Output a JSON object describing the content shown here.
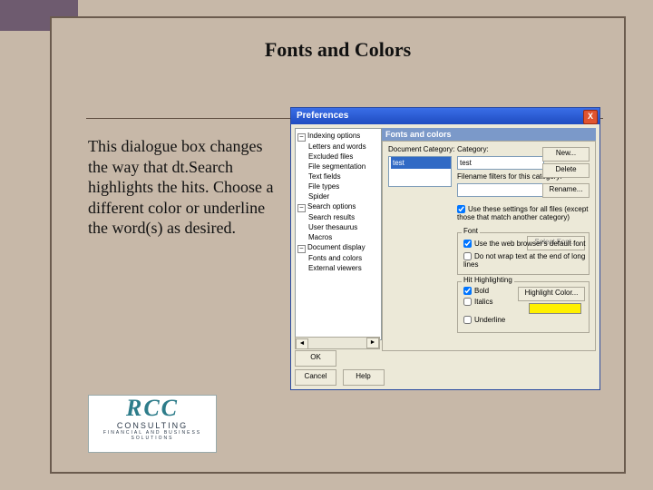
{
  "page_title": "Fonts and Colors",
  "body_text": "This dialogue box changes the way that dt.Search highlights the hits.  Choose a different color or underline the word(s) as desired.",
  "logo": {
    "line1": "RCC",
    "line2": "CONSULTING",
    "line3": "FINANCIAL AND BUSINESS SOLUTIONS"
  },
  "dialog": {
    "title": "Preferences",
    "close_glyph": "X",
    "panel_header": "Fonts and colors",
    "tree": {
      "roots": [
        {
          "label": "Indexing options",
          "children": [
            "Letters and words",
            "Excluded files",
            "File segmentation",
            "Text fields",
            "File types",
            "Spider"
          ]
        },
        {
          "label": "Search options",
          "children": [
            "Search results",
            "User thesaurus",
            "Macros"
          ]
        },
        {
          "label": "Document display",
          "children": [
            "Fonts and colors",
            "External viewers"
          ]
        }
      ]
    },
    "labels": {
      "doc_category": "Document Category:",
      "category": "Category:",
      "filename_filters": "Filename filters for this category:",
      "font": "Font",
      "hit_highlighting": "Hit Highlighting"
    },
    "fields": {
      "category_value": "test",
      "filters_value": ""
    },
    "buttons": {
      "new": "New...",
      "delete": "Delete",
      "rename": "Rename...",
      "select_font": "Select Font...",
      "highlight_color": "Highlight Color...",
      "ok": "OK",
      "cancel": "Cancel",
      "help": "Help"
    },
    "checks": {
      "use_these": "Use these settings for all files (except those that match another category)",
      "use_browser_font": "Use the web browser's default font",
      "no_wrap": "Do not wrap text at the end of long lines",
      "bold": "Bold",
      "italics": "Italics",
      "underline": "Underline"
    },
    "scroll": {
      "left": "◄",
      "right": "►"
    },
    "minus": "–"
  }
}
